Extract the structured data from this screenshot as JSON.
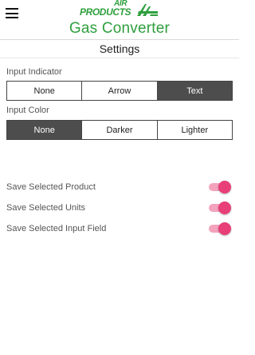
{
  "header": {
    "menu_icon": "hamburger-menu-icon",
    "logo_line1": "AIR",
    "logo_line2": "PRODUCTS",
    "logo_color": "#2e9f3e",
    "app_title": "Gas Converter"
  },
  "page": {
    "title": "Settings"
  },
  "input_indicator": {
    "label": "Input Indicator",
    "options": [
      "None",
      "Arrow",
      "Text"
    ],
    "selected": "Text"
  },
  "input_color": {
    "label": "Input Color",
    "options": [
      "None",
      "Darker",
      "Lighter"
    ],
    "selected": "None"
  },
  "toggles": [
    {
      "label": "Save Selected Product",
      "on": true
    },
    {
      "label": "Save Selected Units",
      "on": true
    },
    {
      "label": "Save Selected Input Field",
      "on": true
    }
  ],
  "colors": {
    "segment_selected": "#4d4d4d",
    "toggle_thumb": "#e83f78",
    "toggle_track": "#f4a3bd"
  }
}
